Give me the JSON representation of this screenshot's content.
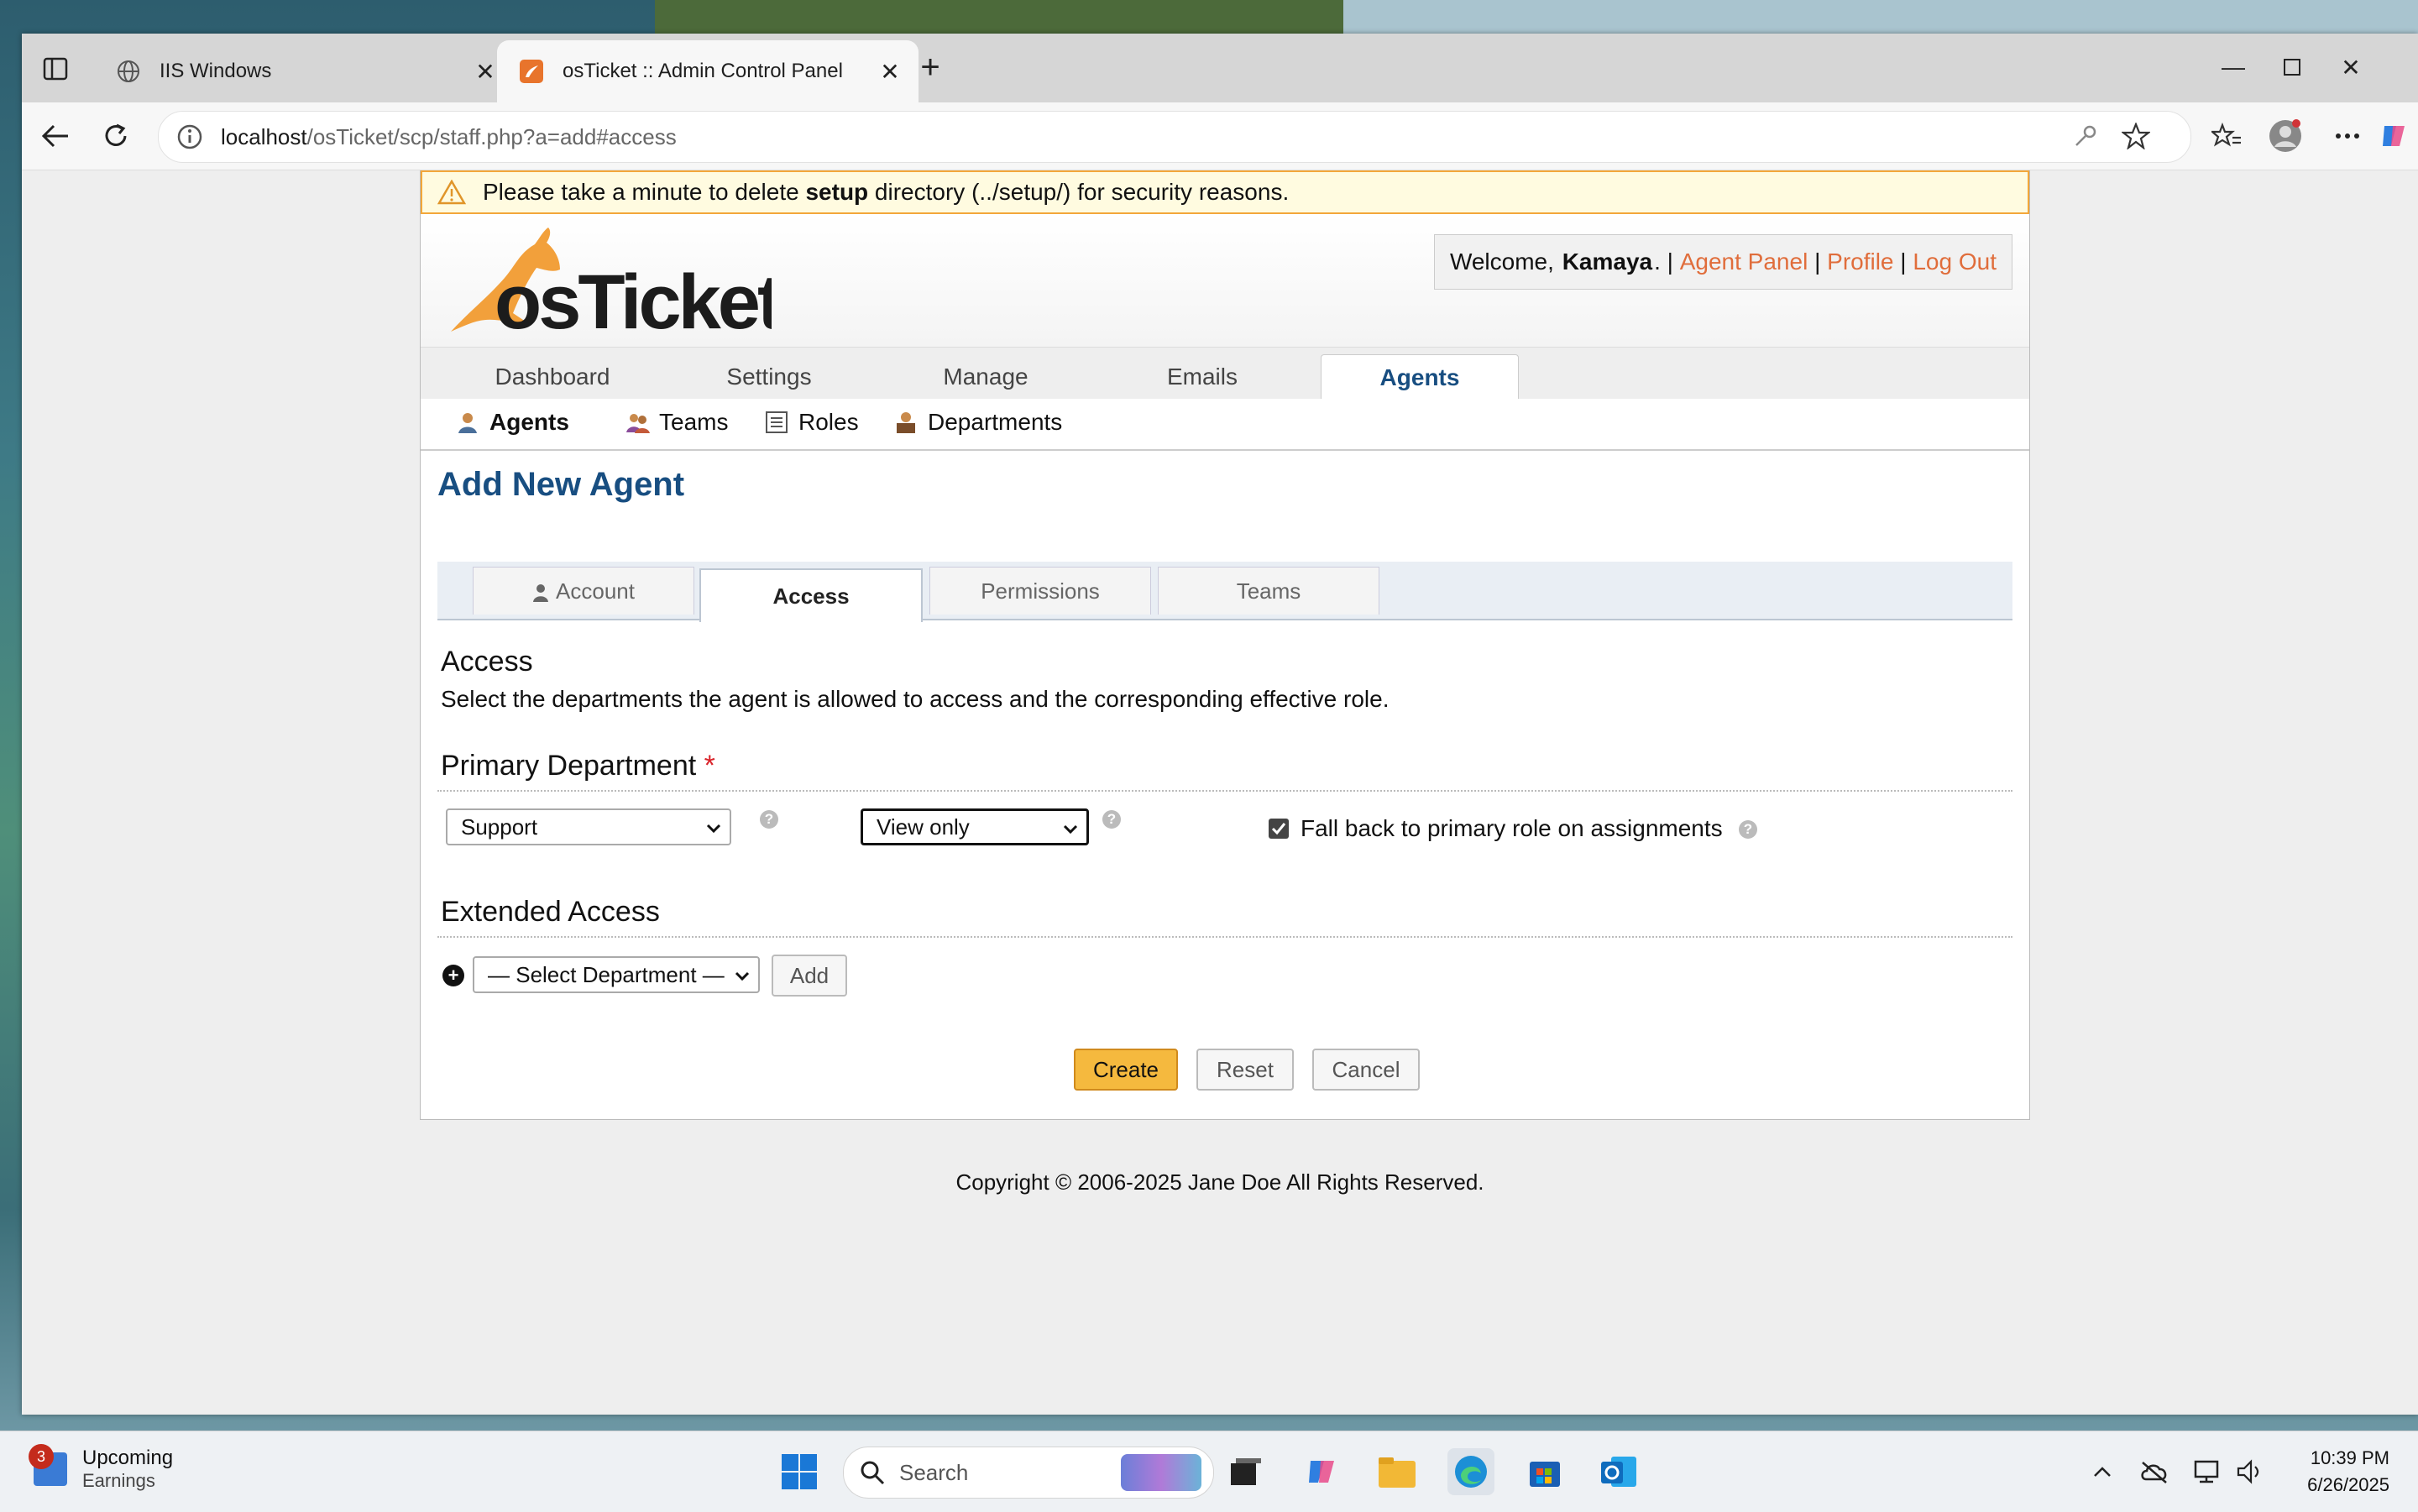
{
  "browser": {
    "tabs": [
      {
        "title": "IIS Windows",
        "active": false
      },
      {
        "title": "osTicket :: Admin Control Panel",
        "active": true
      }
    ],
    "url_host": "localhost",
    "url_path": "/osTicket/scp/staff.php?a=add#access"
  },
  "page": {
    "warning": {
      "prefix": "Please take a minute to delete ",
      "bold": "setup",
      "suffix": " directory (../setup/) for security reasons."
    },
    "logo_text": "osTicket",
    "welcome": {
      "prefix": "Welcome, ",
      "user": "Kamaya",
      "suffix": ". |",
      "links": [
        "Agent Panel",
        "Profile",
        "Log Out"
      ],
      "sep": "|"
    },
    "nav_tabs": [
      "Dashboard",
      "Settings",
      "Manage",
      "Emails",
      "Agents"
    ],
    "nav_active": "Agents",
    "subnav": [
      "Agents",
      "Teams",
      "Roles",
      "Departments"
    ],
    "title": "Add New Agent",
    "form_tabs": [
      "Account",
      "Access",
      "Permissions",
      "Teams"
    ],
    "form_tab_active": "Access",
    "access": {
      "heading": "Access",
      "description": "Select the departments the agent is allowed to access and the corresponding effective role.",
      "primary_heading": "Primary Department",
      "required_mark": "*",
      "department_value": "Support",
      "role_value": "View only",
      "fallback_label": "Fall back to primary role on assignments",
      "fallback_checked": true,
      "extended_heading": "Extended Access",
      "select_department_placeholder": "— Select Department —",
      "add_label": "Add"
    },
    "buttons": {
      "create": "Create",
      "reset": "Reset",
      "cancel": "Cancel"
    },
    "copyright": "Copyright © 2006-2025 Jane Doe All Rights Reserved."
  },
  "taskbar": {
    "widget_title": "Upcoming",
    "widget_sub": "Earnings",
    "widget_badge": "3",
    "search_placeholder": "Search",
    "time": "10:39 PM",
    "date": "6/26/2025"
  },
  "colors": {
    "accent": "#184e81",
    "link": "#e06d3b",
    "warning_border": "#f3a73a",
    "primary_button": "#f5b93e"
  }
}
